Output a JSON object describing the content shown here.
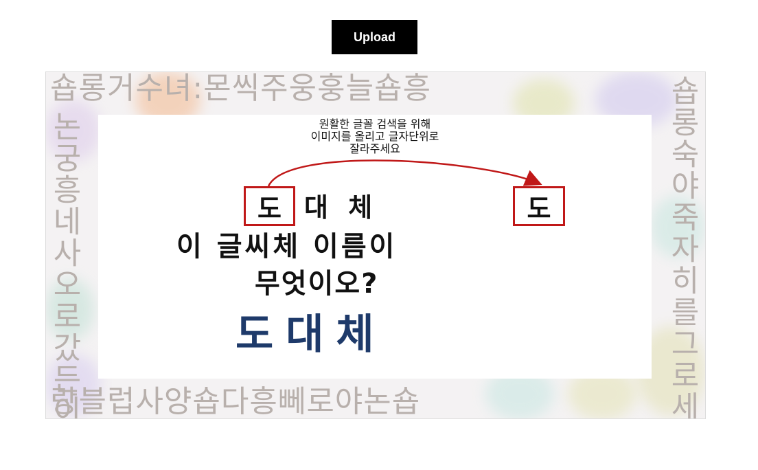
{
  "toolbar": {
    "upload_label": "Upload"
  },
  "image": {
    "background_chars": {
      "top": "숍롱거수녀:몬씩주웅훙늘숍흥",
      "left": "논궁흥네사오로갔든이랑",
      "right": "숍롱숙야죽자히를그로세숍",
      "bottom": "랑블럽사양숍다흥뻬로야논숍"
    },
    "instruction_lines": [
      "원활한 글꼴 검색을 위해",
      "이미지를 올리고 글자단위로",
      "잘라주세요"
    ],
    "left_box_char": "도",
    "right_box_char": "도",
    "line1_rest": "대 체",
    "line2": "이 글씨체 이름이",
    "line3": "무엇이오?",
    "answer": "도대체",
    "colors": {
      "box": "#c01818",
      "arrow": "#c01818",
      "answer": "#1e3a6a"
    }
  }
}
